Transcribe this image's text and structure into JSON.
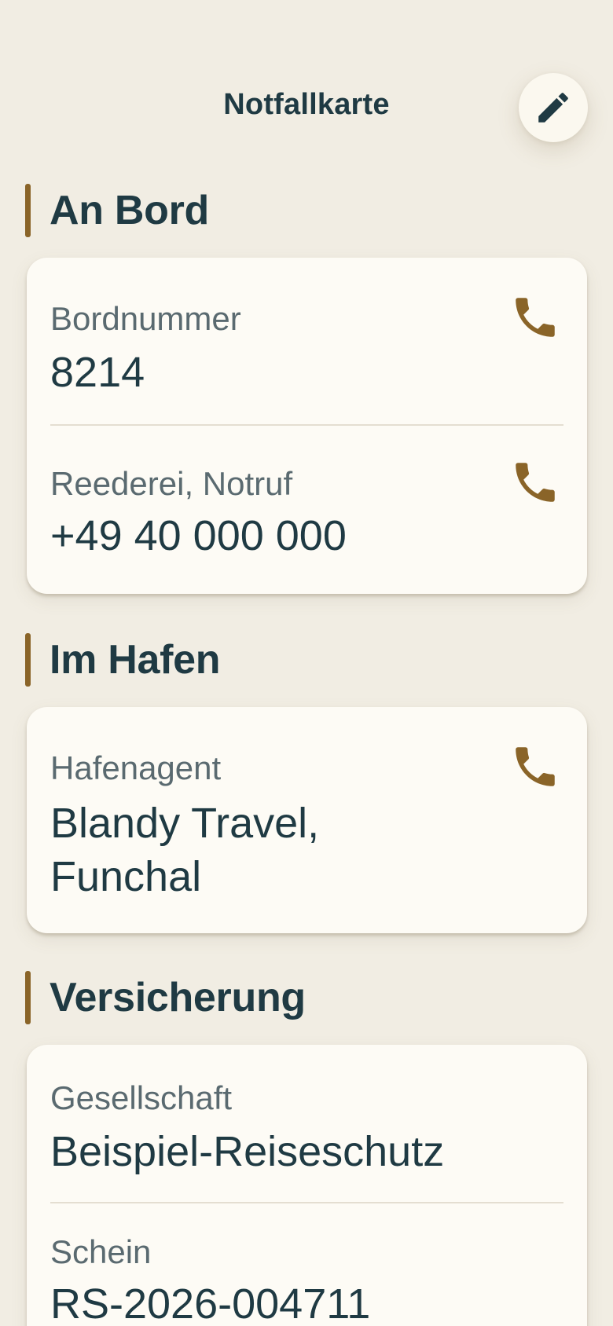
{
  "header": {
    "title": "Notfallkarte",
    "edit_icon": "pencil-icon"
  },
  "colors": {
    "background": "#f1ede3",
    "card": "#fdfbf5",
    "accent": "#8a6428",
    "text": "#1f3a43",
    "label": "#5a6a70"
  },
  "sections": [
    {
      "title": "An Bord",
      "rows": [
        {
          "label": "Bordnummer",
          "value": "8214",
          "callable": true
        },
        {
          "label": "Reederei, Notruf",
          "value": "+49 40 000 000",
          "callable": true
        }
      ]
    },
    {
      "title": "Im Hafen",
      "rows": [
        {
          "label": "Hafenagent",
          "value_lines": [
            "Blandy Travel,",
            "Funchal"
          ],
          "callable": true
        }
      ]
    },
    {
      "title": "Versicherung",
      "rows": [
        {
          "label": "Gesellschaft",
          "value": "Beispiel-Reiseschutz",
          "callable": false
        },
        {
          "label": "Schein",
          "value": "RS-2026-004711",
          "callable": false
        }
      ]
    }
  ]
}
